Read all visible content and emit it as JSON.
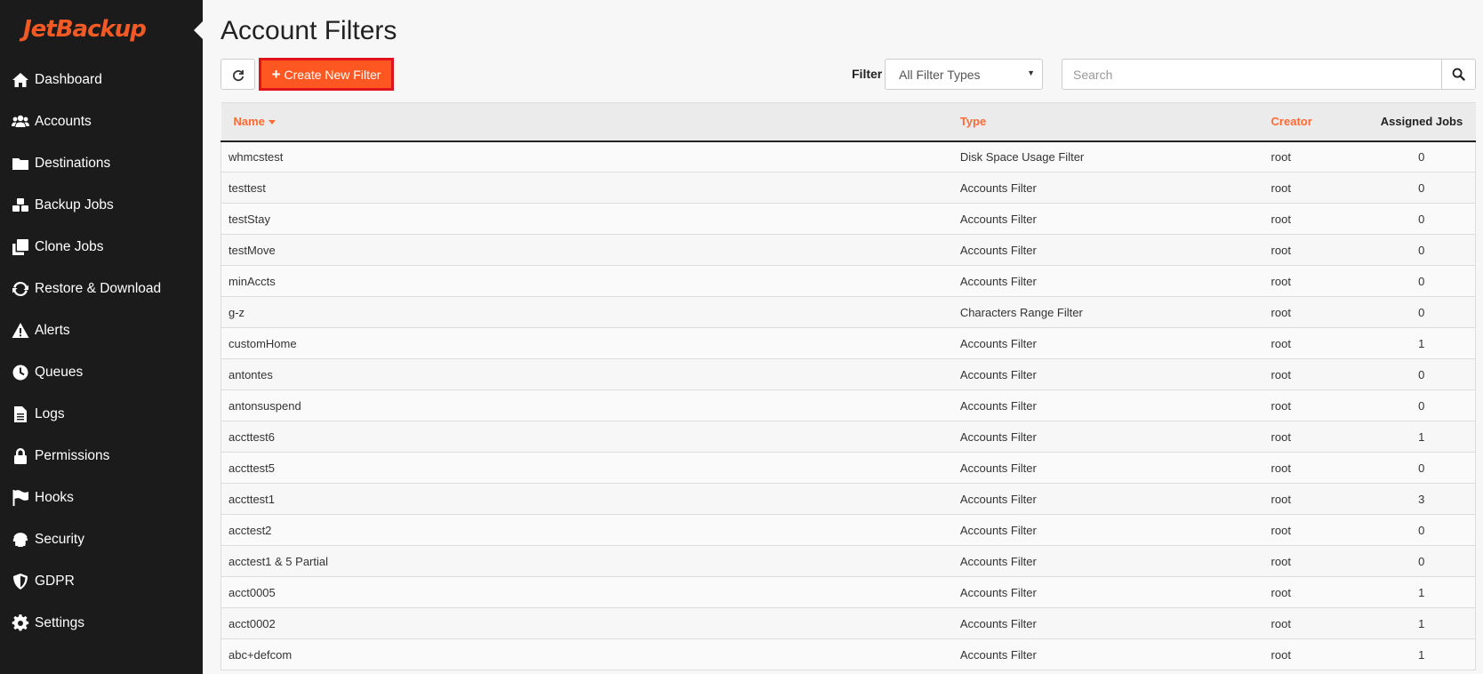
{
  "brand": {
    "logo_text": "JetBackup",
    "accent": "#f15a24"
  },
  "sidebar": {
    "items": [
      {
        "label": "Dashboard",
        "icon": "home-icon"
      },
      {
        "label": "Accounts",
        "icon": "users-icon"
      },
      {
        "label": "Destinations",
        "icon": "folder-icon"
      },
      {
        "label": "Backup Jobs",
        "icon": "cubes-icon"
      },
      {
        "label": "Clone Jobs",
        "icon": "clone-icon"
      },
      {
        "label": "Restore & Download",
        "icon": "refresh-icon"
      },
      {
        "label": "Alerts",
        "icon": "warning-icon"
      },
      {
        "label": "Queues",
        "icon": "clock-icon"
      },
      {
        "label": "Logs",
        "icon": "file-icon"
      },
      {
        "label": "Permissions",
        "icon": "lock-icon"
      },
      {
        "label": "Hooks",
        "icon": "flag-icon"
      },
      {
        "label": "Security",
        "icon": "fingerprint-icon"
      },
      {
        "label": "GDPR",
        "icon": "shield-icon"
      },
      {
        "label": "Settings",
        "icon": "gear-icon"
      }
    ]
  },
  "page": {
    "title": "Account Filters"
  },
  "toolbar": {
    "create_label": "Create New Filter",
    "filter_label": "Filter",
    "filter_selected": "All Filter Types",
    "search_placeholder": "Search"
  },
  "table": {
    "headers": {
      "name": "Name",
      "type": "Type",
      "creator": "Creator",
      "jobs": "Assigned Jobs"
    },
    "rows": [
      {
        "name": "whmcstest",
        "type": "Disk Space Usage Filter",
        "creator": "root",
        "jobs": "0"
      },
      {
        "name": "testtest",
        "type": "Accounts Filter",
        "creator": "root",
        "jobs": "0"
      },
      {
        "name": "testStay",
        "type": "Accounts Filter",
        "creator": "root",
        "jobs": "0"
      },
      {
        "name": "testMove",
        "type": "Accounts Filter",
        "creator": "root",
        "jobs": "0"
      },
      {
        "name": "minAccts",
        "type": "Accounts Filter",
        "creator": "root",
        "jobs": "0"
      },
      {
        "name": "g-z",
        "type": "Characters Range Filter",
        "creator": "root",
        "jobs": "0"
      },
      {
        "name": "customHome",
        "type": "Accounts Filter",
        "creator": "root",
        "jobs": "1"
      },
      {
        "name": "antontes",
        "type": "Accounts Filter",
        "creator": "root",
        "jobs": "0"
      },
      {
        "name": "antonsuspend",
        "type": "Accounts Filter",
        "creator": "root",
        "jobs": "0"
      },
      {
        "name": "accttest6",
        "type": "Accounts Filter",
        "creator": "root",
        "jobs": "1"
      },
      {
        "name": "accttest5",
        "type": "Accounts Filter",
        "creator": "root",
        "jobs": "0"
      },
      {
        "name": "accttest1",
        "type": "Accounts Filter",
        "creator": "root",
        "jobs": "3"
      },
      {
        "name": "acctest2",
        "type": "Accounts Filter",
        "creator": "root",
        "jobs": "0"
      },
      {
        "name": "acctest1 & 5 Partial",
        "type": "Accounts Filter",
        "creator": "root",
        "jobs": "0"
      },
      {
        "name": "acct0005",
        "type": "Accounts Filter",
        "creator": "root",
        "jobs": "1"
      },
      {
        "name": "acct0002",
        "type": "Accounts Filter",
        "creator": "root",
        "jobs": "1"
      },
      {
        "name": "abc+defcom",
        "type": "Accounts Filter",
        "creator": "root",
        "jobs": "1"
      }
    ]
  }
}
